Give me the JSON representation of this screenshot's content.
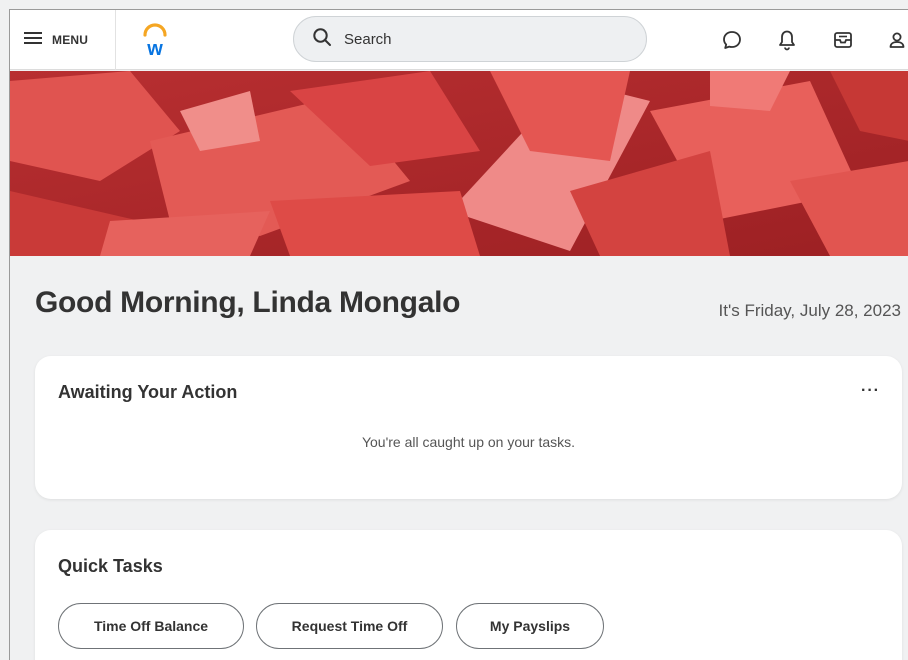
{
  "header": {
    "menu_label": "MENU",
    "search_placeholder": "Search",
    "icons": [
      "menu-icon",
      "workday-logo",
      "search-icon",
      "chat-icon",
      "bell-icon",
      "inbox-icon",
      "profile-icon"
    ]
  },
  "greeting": {
    "title": "Good Morning, Linda Mongalo",
    "date": "It's Friday, July 28, 2023"
  },
  "awaiting": {
    "title": "Awaiting Your Action",
    "more": "···",
    "empty": "You're all caught up on your tasks."
  },
  "quick_tasks": {
    "title": "Quick Tasks",
    "buttons": [
      "Time Off Balance",
      "Request Time Off",
      "My Payslips"
    ]
  },
  "colors": {
    "logo_blue": "#0875e1",
    "logo_orange": "#f5a623",
    "banner_red": "#d94444"
  }
}
